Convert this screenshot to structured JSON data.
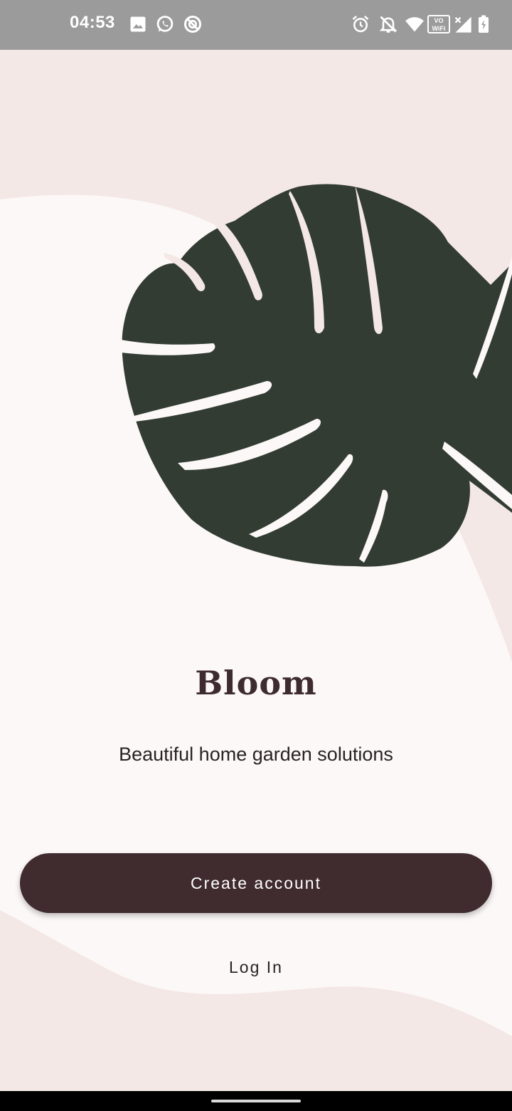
{
  "status_bar": {
    "time": "04:53",
    "left_icons": [
      "image-icon",
      "whatsapp-icon",
      "data-saver-icon"
    ],
    "right_icons": [
      "alarm-icon",
      "notifications-off-icon",
      "wifi-icon",
      "vowifi-icon",
      "signal-icon",
      "battery-charging-icon"
    ],
    "vowifi_top": "VO",
    "vowifi_bottom": "WiFi"
  },
  "welcome": {
    "app_name": "Bloom",
    "tagline": "Beautiful home garden solutions",
    "create_account_label": "Create account",
    "login_label": "Log In"
  },
  "colors": {
    "background": "#f4e8e6",
    "surface": "#fcf8f7",
    "leaf": "#323c33",
    "primary_button": "#402b2e",
    "status_bar": "#9b9b9b"
  }
}
